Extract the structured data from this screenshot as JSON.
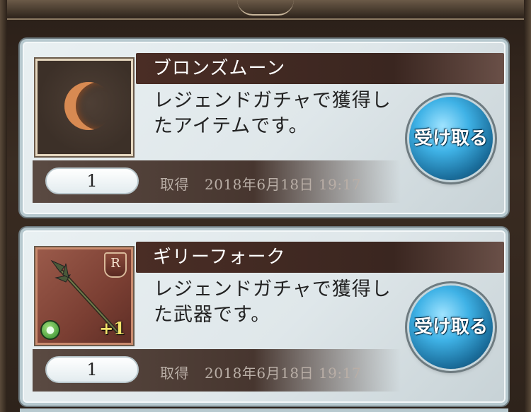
{
  "items": [
    {
      "name": "ブロンズムーン",
      "description_line1": "レジェンドガチャで獲得し",
      "description_line2": "たアイテムです。",
      "quantity": "1",
      "acquired_label": "取得",
      "acquired_date": "2018年6月18日  19:17",
      "receive_label": "受け取る",
      "icon": "bronze-moon-icon"
    },
    {
      "name": "ギリーフォーク",
      "description_line1": "レジェンドガチャで獲得し",
      "description_line2": "た武器です。",
      "quantity": "1",
      "acquired_label": "取得",
      "acquired_date": "2018年6月18日  19:17",
      "receive_label": "受け取る",
      "icon": "spear-icon",
      "rank": "R",
      "plus": "+1"
    }
  ],
  "colors": {
    "title_bar": "#3a2620",
    "card_bg": "#e9f0f2",
    "button": "#3fb2e6"
  }
}
